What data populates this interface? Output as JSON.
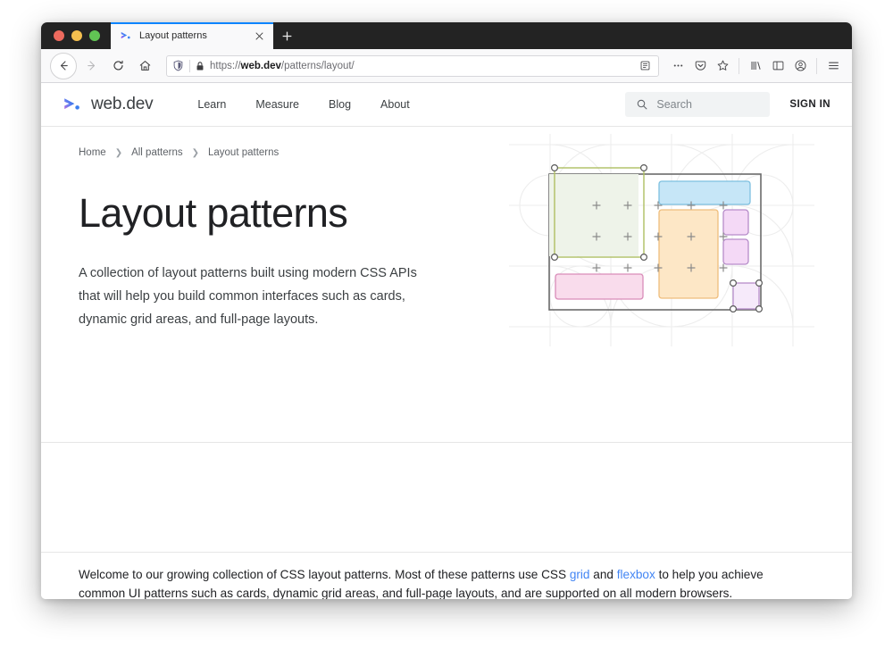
{
  "browser": {
    "tab": {
      "title": "Layout patterns",
      "favicon": "webdev-logo-icon",
      "close": "×",
      "newtab": "+"
    },
    "toolbar": {
      "back": "back-arrow-icon",
      "forward": "forward-arrow-icon",
      "reload": "reload-icon",
      "home": "home-icon",
      "url": {
        "scheme": "https://",
        "host": "web.dev",
        "path": "/patterns/layout/"
      },
      "reader": "reader-mode-icon",
      "page_actions": "…",
      "pocket": "pocket-icon",
      "bookmark": "star-icon",
      "library": "library-icon",
      "sidebar": "sidebar-icon",
      "account": "account-icon",
      "menu": "hamburger-menu-icon"
    }
  },
  "site": {
    "brand": "web.dev",
    "nav": [
      {
        "label": "Learn"
      },
      {
        "label": "Measure"
      },
      {
        "label": "Blog"
      },
      {
        "label": "About"
      }
    ],
    "search": {
      "placeholder": "Search",
      "icon": "search-icon"
    },
    "signin": "SIGN IN"
  },
  "breadcrumb": {
    "items": [
      {
        "label": "Home"
      },
      {
        "label": "All patterns"
      },
      {
        "label": "Layout patterns"
      }
    ],
    "separator": "❯"
  },
  "hero": {
    "title": "Layout patterns",
    "subtitle": "A collection of layout patterns built using modern CSS APIs that will help you build common interfaces such as cards, dynamic grid areas, and full-page layouts."
  },
  "intro": {
    "part1": "Welcome to our growing collection of CSS layout patterns. Most of these patterns use CSS ",
    "link1": "grid",
    "part2": " and ",
    "link2": "flexbox",
    "part3": " to help you achieve common UI patterns such as cards, dynamic grid areas, and full-page layouts, and are supported on all modern browsers."
  },
  "colors": {
    "accent_link": "#4285f4",
    "tab_active_border": "#0a84ff",
    "art_green_fill": "#eef3e9",
    "art_green_stroke": "#aebe62",
    "art_blue_fill": "#c6e6f7",
    "art_blue_stroke": "#7ec0e0",
    "art_orange_fill": "#fde7c6",
    "art_orange_stroke": "#efbd7c",
    "art_pink_fill": "#f9dcec",
    "art_pink_stroke": "#d98cb9",
    "art_purple_fill": "#f4d9f6",
    "art_purple_stroke": "#b68cc9",
    "art_frame_stroke": "#6b6b6b",
    "art_bg_pattern": "#eeeeee"
  }
}
